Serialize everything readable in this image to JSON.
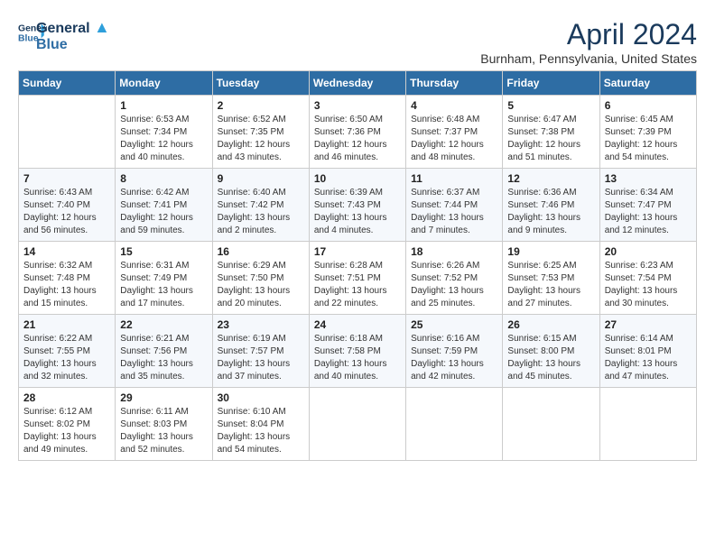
{
  "header": {
    "logo_line1": "General",
    "logo_line2": "Blue",
    "month": "April 2024",
    "location": "Burnham, Pennsylvania, United States"
  },
  "weekdays": [
    "Sunday",
    "Monday",
    "Tuesday",
    "Wednesday",
    "Thursday",
    "Friday",
    "Saturday"
  ],
  "weeks": [
    [
      {
        "day": "",
        "sunrise": "",
        "sunset": "",
        "daylight": ""
      },
      {
        "day": "1",
        "sunrise": "Sunrise: 6:53 AM",
        "sunset": "Sunset: 7:34 PM",
        "daylight": "Daylight: 12 hours and 40 minutes."
      },
      {
        "day": "2",
        "sunrise": "Sunrise: 6:52 AM",
        "sunset": "Sunset: 7:35 PM",
        "daylight": "Daylight: 12 hours and 43 minutes."
      },
      {
        "day": "3",
        "sunrise": "Sunrise: 6:50 AM",
        "sunset": "Sunset: 7:36 PM",
        "daylight": "Daylight: 12 hours and 46 minutes."
      },
      {
        "day": "4",
        "sunrise": "Sunrise: 6:48 AM",
        "sunset": "Sunset: 7:37 PM",
        "daylight": "Daylight: 12 hours and 48 minutes."
      },
      {
        "day": "5",
        "sunrise": "Sunrise: 6:47 AM",
        "sunset": "Sunset: 7:38 PM",
        "daylight": "Daylight: 12 hours and 51 minutes."
      },
      {
        "day": "6",
        "sunrise": "Sunrise: 6:45 AM",
        "sunset": "Sunset: 7:39 PM",
        "daylight": "Daylight: 12 hours and 54 minutes."
      }
    ],
    [
      {
        "day": "7",
        "sunrise": "Sunrise: 6:43 AM",
        "sunset": "Sunset: 7:40 PM",
        "daylight": "Daylight: 12 hours and 56 minutes."
      },
      {
        "day": "8",
        "sunrise": "Sunrise: 6:42 AM",
        "sunset": "Sunset: 7:41 PM",
        "daylight": "Daylight: 12 hours and 59 minutes."
      },
      {
        "day": "9",
        "sunrise": "Sunrise: 6:40 AM",
        "sunset": "Sunset: 7:42 PM",
        "daylight": "Daylight: 13 hours and 2 minutes."
      },
      {
        "day": "10",
        "sunrise": "Sunrise: 6:39 AM",
        "sunset": "Sunset: 7:43 PM",
        "daylight": "Daylight: 13 hours and 4 minutes."
      },
      {
        "day": "11",
        "sunrise": "Sunrise: 6:37 AM",
        "sunset": "Sunset: 7:44 PM",
        "daylight": "Daylight: 13 hours and 7 minutes."
      },
      {
        "day": "12",
        "sunrise": "Sunrise: 6:36 AM",
        "sunset": "Sunset: 7:46 PM",
        "daylight": "Daylight: 13 hours and 9 minutes."
      },
      {
        "day": "13",
        "sunrise": "Sunrise: 6:34 AM",
        "sunset": "Sunset: 7:47 PM",
        "daylight": "Daylight: 13 hours and 12 minutes."
      }
    ],
    [
      {
        "day": "14",
        "sunrise": "Sunrise: 6:32 AM",
        "sunset": "Sunset: 7:48 PM",
        "daylight": "Daylight: 13 hours and 15 minutes."
      },
      {
        "day": "15",
        "sunrise": "Sunrise: 6:31 AM",
        "sunset": "Sunset: 7:49 PM",
        "daylight": "Daylight: 13 hours and 17 minutes."
      },
      {
        "day": "16",
        "sunrise": "Sunrise: 6:29 AM",
        "sunset": "Sunset: 7:50 PM",
        "daylight": "Daylight: 13 hours and 20 minutes."
      },
      {
        "day": "17",
        "sunrise": "Sunrise: 6:28 AM",
        "sunset": "Sunset: 7:51 PM",
        "daylight": "Daylight: 13 hours and 22 minutes."
      },
      {
        "day": "18",
        "sunrise": "Sunrise: 6:26 AM",
        "sunset": "Sunset: 7:52 PM",
        "daylight": "Daylight: 13 hours and 25 minutes."
      },
      {
        "day": "19",
        "sunrise": "Sunrise: 6:25 AM",
        "sunset": "Sunset: 7:53 PM",
        "daylight": "Daylight: 13 hours and 27 minutes."
      },
      {
        "day": "20",
        "sunrise": "Sunrise: 6:23 AM",
        "sunset": "Sunset: 7:54 PM",
        "daylight": "Daylight: 13 hours and 30 minutes."
      }
    ],
    [
      {
        "day": "21",
        "sunrise": "Sunrise: 6:22 AM",
        "sunset": "Sunset: 7:55 PM",
        "daylight": "Daylight: 13 hours and 32 minutes."
      },
      {
        "day": "22",
        "sunrise": "Sunrise: 6:21 AM",
        "sunset": "Sunset: 7:56 PM",
        "daylight": "Daylight: 13 hours and 35 minutes."
      },
      {
        "day": "23",
        "sunrise": "Sunrise: 6:19 AM",
        "sunset": "Sunset: 7:57 PM",
        "daylight": "Daylight: 13 hours and 37 minutes."
      },
      {
        "day": "24",
        "sunrise": "Sunrise: 6:18 AM",
        "sunset": "Sunset: 7:58 PM",
        "daylight": "Daylight: 13 hours and 40 minutes."
      },
      {
        "day": "25",
        "sunrise": "Sunrise: 6:16 AM",
        "sunset": "Sunset: 7:59 PM",
        "daylight": "Daylight: 13 hours and 42 minutes."
      },
      {
        "day": "26",
        "sunrise": "Sunrise: 6:15 AM",
        "sunset": "Sunset: 8:00 PM",
        "daylight": "Daylight: 13 hours and 45 minutes."
      },
      {
        "day": "27",
        "sunrise": "Sunrise: 6:14 AM",
        "sunset": "Sunset: 8:01 PM",
        "daylight": "Daylight: 13 hours and 47 minutes."
      }
    ],
    [
      {
        "day": "28",
        "sunrise": "Sunrise: 6:12 AM",
        "sunset": "Sunset: 8:02 PM",
        "daylight": "Daylight: 13 hours and 49 minutes."
      },
      {
        "day": "29",
        "sunrise": "Sunrise: 6:11 AM",
        "sunset": "Sunset: 8:03 PM",
        "daylight": "Daylight: 13 hours and 52 minutes."
      },
      {
        "day": "30",
        "sunrise": "Sunrise: 6:10 AM",
        "sunset": "Sunset: 8:04 PM",
        "daylight": "Daylight: 13 hours and 54 minutes."
      },
      {
        "day": "",
        "sunrise": "",
        "sunset": "",
        "daylight": ""
      },
      {
        "day": "",
        "sunrise": "",
        "sunset": "",
        "daylight": ""
      },
      {
        "day": "",
        "sunrise": "",
        "sunset": "",
        "daylight": ""
      },
      {
        "day": "",
        "sunrise": "",
        "sunset": "",
        "daylight": ""
      }
    ]
  ]
}
